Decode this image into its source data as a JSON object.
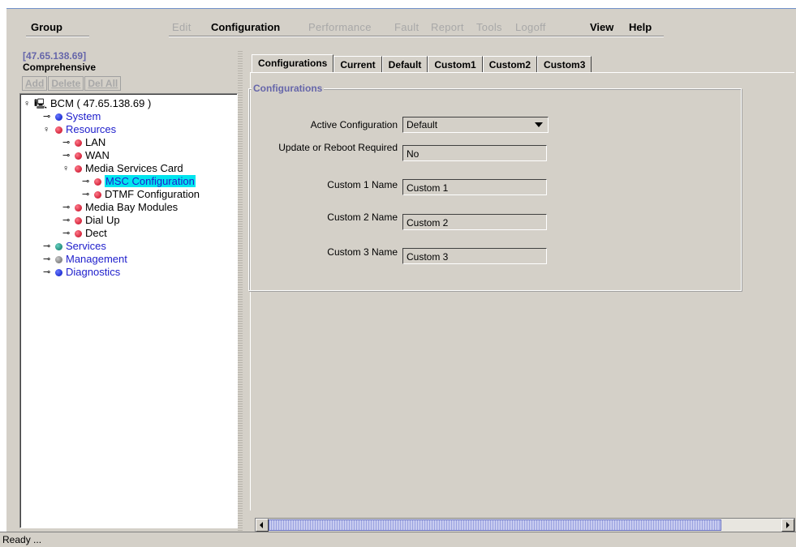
{
  "menu": {
    "group": "Group",
    "edit": "Edit",
    "configuration": "Configuration",
    "performance": "Performance",
    "fault": "Fault",
    "report": "Report",
    "tools": "Tools",
    "logoff": "Logoff",
    "view": "View",
    "help": "Help"
  },
  "left": {
    "ip": "[47.65.138.69]",
    "mode": "Comprehensive",
    "buttons": {
      "add": "Add",
      "delete": "Delete",
      "delall": "Del All"
    }
  },
  "tree": {
    "root": "BCM ( 47.65.138.69 )",
    "system": "System",
    "resources": "Resources",
    "lan": "LAN",
    "wan": "WAN",
    "msc_card": "Media Services Card",
    "msc_config": "MSC Configuration",
    "dtmf_config": "DTMF Configuration",
    "media_bay": "Media Bay Modules",
    "dial_up": "Dial Up",
    "dect": "Dect",
    "services": "Services",
    "management": "Management",
    "diagnostics": "Diagnostics"
  },
  "tabs": [
    "Configurations",
    "Current",
    "Default",
    "Custom1",
    "Custom2",
    "Custom3"
  ],
  "group_title": "Configurations",
  "form": {
    "active_label": "Active Configuration",
    "active_value": "Default",
    "reboot_label": "Update or Reboot Required",
    "reboot_value": "No",
    "custom1_label": "Custom 1 Name",
    "custom1_value": "Custom 1",
    "custom2_label": "Custom 2 Name",
    "custom2_value": "Custom 2",
    "custom3_label": "Custom 3 Name",
    "custom3_value": "Custom 3"
  },
  "status": "Ready ...",
  "colors": {
    "selection": "#00e5ee",
    "tree_text": "#2020cc",
    "header_text": "#6666aa"
  }
}
